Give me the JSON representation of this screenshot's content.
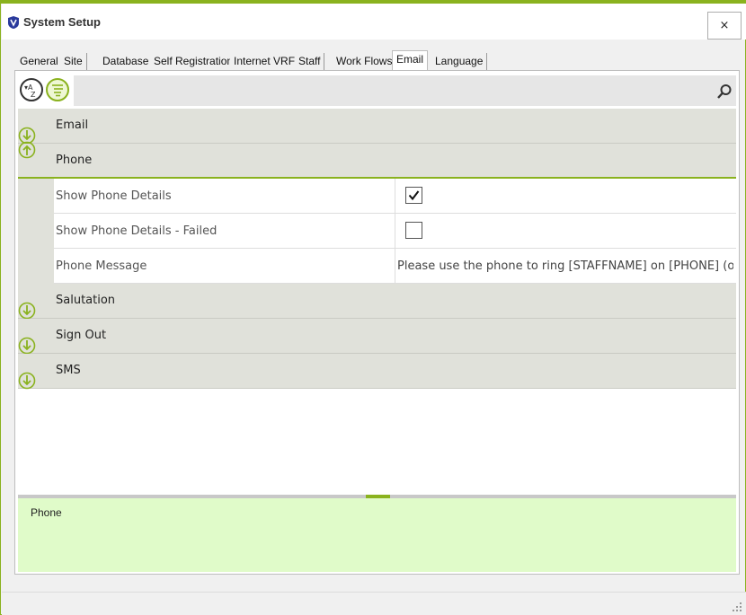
{
  "window": {
    "title": "System Setup",
    "close_label": "×"
  },
  "tabs": [
    {
      "label": "General"
    },
    {
      "label": "Site"
    },
    {
      "label": "Database"
    },
    {
      "label": "Self Registration"
    },
    {
      "label": "Internet VRF"
    },
    {
      "label": "Staff"
    },
    {
      "label": "Work Flows"
    },
    {
      "label": "Email",
      "active": true
    },
    {
      "label": "Language"
    }
  ],
  "toolbar": {
    "sort_alpha_icon": "sort-alphabetical-icon",
    "categorized_icon": "categorized-icon",
    "search_icon": "search-icon"
  },
  "grid": {
    "categories": [
      {
        "label": "Email",
        "expanded": false
      },
      {
        "label": "Phone",
        "expanded": true,
        "properties": [
          {
            "name": "Show Phone Details",
            "type": "checkbox",
            "checked": true
          },
          {
            "name": "Show Phone Details - Failed",
            "type": "checkbox",
            "checked": false
          },
          {
            "name": "Phone Message",
            "type": "text",
            "value": "Please use the phone to ring [STAFFNAME] on [PHONE] (or"
          }
        ]
      },
      {
        "label": "Salutation",
        "expanded": false
      },
      {
        "label": "Sign Out",
        "expanded": false
      },
      {
        "label": "SMS",
        "expanded": false
      }
    ]
  },
  "description": {
    "title": "Phone"
  },
  "colors": {
    "accent": "#8ab21e",
    "category_bg": "#e0e1da",
    "description_bg": "#e0fbc9"
  }
}
